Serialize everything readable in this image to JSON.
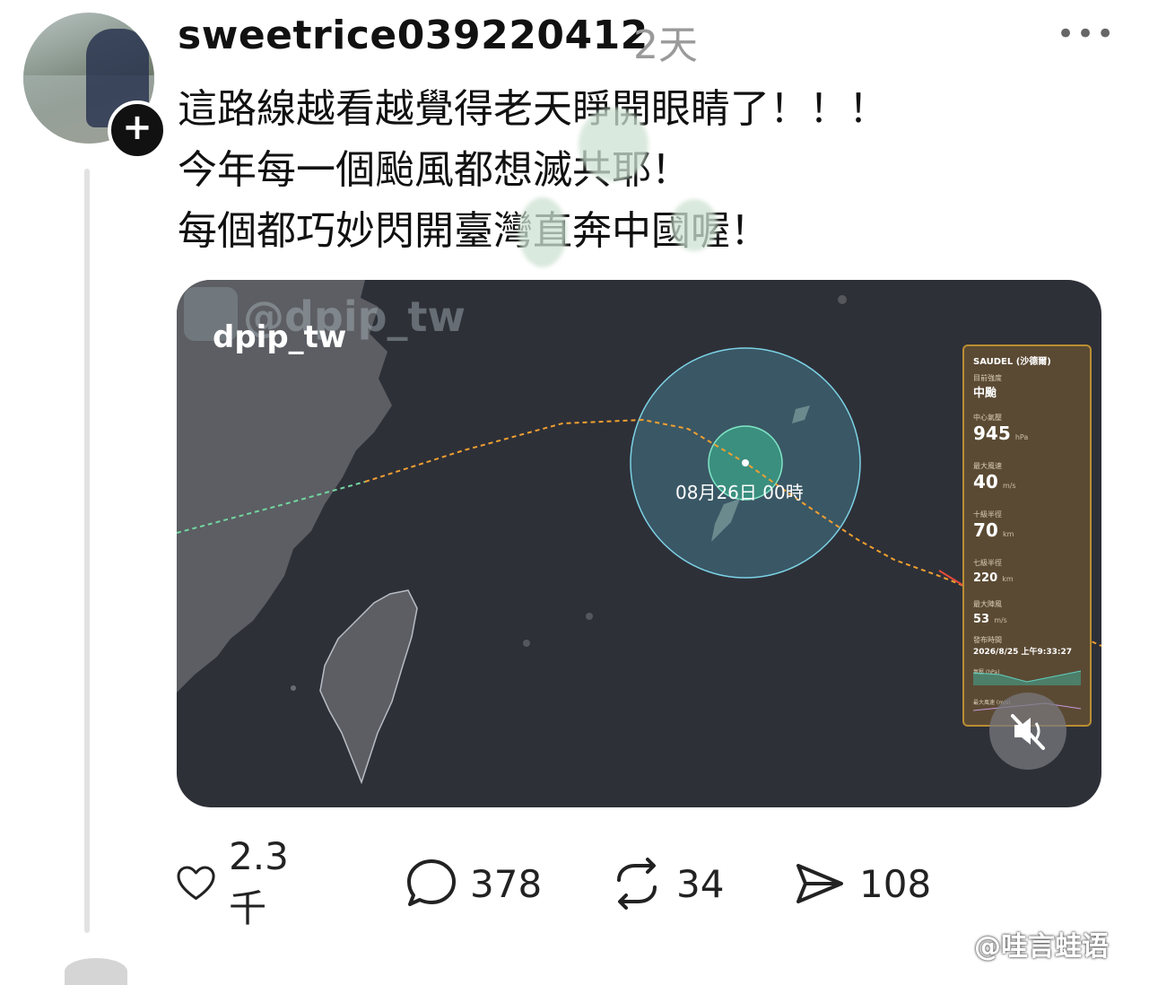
{
  "post": {
    "username": "sweetrice039220412",
    "time": "2天",
    "more_icon": "more-horizontal-icon",
    "lines": [
      "這路線越看越覺得老天睜開眼睛了！！！",
      "今年每一個颱風都想滅共耶！",
      "每個都巧妙閃開臺灣直奔中國喔！"
    ]
  },
  "media": {
    "watermark_faded": "@dpip_tw",
    "watermark": "dpip_tw",
    "storm_time_label": "08月26日 00時",
    "panel": {
      "title": "SAUDEL (沙德爾)",
      "intensity_label": "目前強度",
      "intensity_value": "中颱",
      "pressure_label": "中心氣壓",
      "pressure_value": "945",
      "pressure_unit": "hPa",
      "wind_label": "最大風速",
      "wind_value": "40",
      "wind_unit": "m/s",
      "r10_label": "十級半徑",
      "r10_value": "70",
      "r10_unit": "km",
      "r7_label": "七級半徑",
      "r7_value": "220",
      "r7_unit": "km",
      "gust_label": "最大陣風",
      "gust_value": "53",
      "gust_unit": "m/s",
      "issued_label": "發布時間",
      "issued_value": "2026/8/25 上午9:33:27",
      "chart1_label": "氣壓 (hPa)",
      "chart2_label": "最大風速 (m/s)"
    },
    "mute_icon": "speaker-muted-icon"
  },
  "actions": {
    "like": "2.3千",
    "comment": "378",
    "repost": "34",
    "share": "108"
  },
  "weibo_watermark": "@哇言蛙语",
  "colors": {
    "map_bg": "#2e3038",
    "land": "#5c5e63",
    "track_dashed": "#f0a030",
    "panel_bg": "#5b4a33",
    "panel_border": "#b98d33"
  }
}
